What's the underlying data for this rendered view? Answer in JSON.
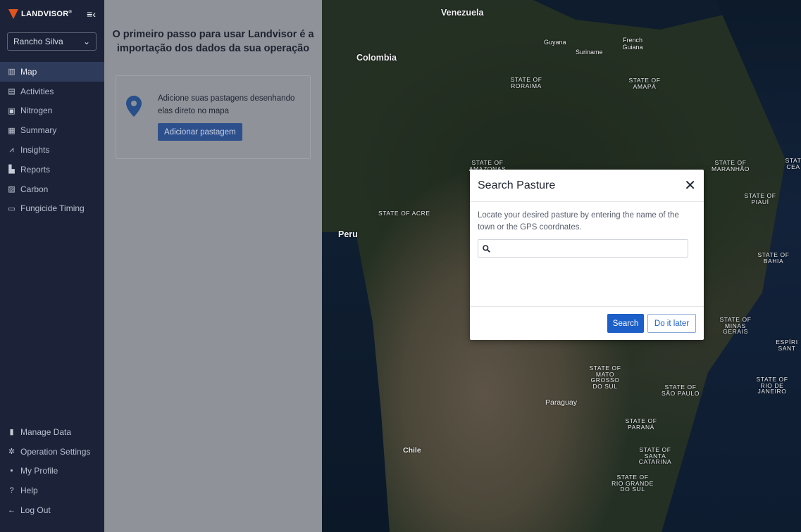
{
  "brand": {
    "name": "LANDVISOR",
    "mark": "®"
  },
  "farm_select": {
    "value": "Rancho Silva"
  },
  "nav": {
    "items": [
      {
        "label": "Map",
        "icon": "map-icon"
      },
      {
        "label": "Activities",
        "icon": "clipboard-icon"
      },
      {
        "label": "Nitrogen",
        "icon": "nitrogen-icon"
      },
      {
        "label": "Summary",
        "icon": "summary-icon"
      },
      {
        "label": "Insights",
        "icon": "chart-line-icon"
      },
      {
        "label": "Reports",
        "icon": "report-icon"
      },
      {
        "label": "Carbon",
        "icon": "carbon-icon"
      },
      {
        "label": "Fungicide Timing",
        "icon": "calendar-icon"
      }
    ],
    "bottom": [
      {
        "label": "Manage Data",
        "icon": "data-icon"
      },
      {
        "label": "Operation Settings",
        "icon": "gear-icon"
      },
      {
        "label": "My Profile",
        "icon": "profile-icon"
      },
      {
        "label": "Help",
        "icon": "help-icon"
      },
      {
        "label": "Log Out",
        "icon": "logout-icon"
      }
    ]
  },
  "panel": {
    "title": "O primeiro passo para usar Landvisor é a importação dos dados da sua operação",
    "card_text": "Adicione suas pastagens desenhando elas direto no mapa",
    "card_button": "Adicionar pastagem"
  },
  "map_labels": {
    "venezuela": "Venezuela",
    "colombia": "Colombia",
    "guyana": "Guyana",
    "suriname": "Suriname",
    "french_guiana": "French Guiana",
    "roraima": "STATE OF RORAIMA",
    "amapa": "STATE OF AMAPÁ",
    "amazonas": "STATE OF AMAZONAS",
    "maranhao": "STATE OF MARANHÃO",
    "ceara": "STAT CEA",
    "piaui": "STATE OF PIAUÍ",
    "acre": "STATE OF ACRE",
    "peru": "Peru",
    "bahia": "STATE OF BAHIA",
    "minas": "STATE OF MINAS GERAIS",
    "espirito": "ESPÍRI SANT",
    "mato_grosso_sul": "STATE OF MATO GROSSO DO SUL",
    "sao_paulo": "STATE OF SÃO PAULO",
    "rio": "STATE OF RIO DE JANEIRO",
    "paraguay": "Paraguay",
    "parana": "STATE OF PARANÁ",
    "santa_catarina": "STATE OF SANTA CATARINA",
    "chile": "Chile",
    "rio_grande": "STATE OF RIO GRANDE DO SUL"
  },
  "modal": {
    "title": "Search Pasture",
    "description": "Locate your desired pasture by entering the name of the town or the GPS coordnates.",
    "search_value": "",
    "search_button": "Search",
    "later_button": "Do it later"
  }
}
